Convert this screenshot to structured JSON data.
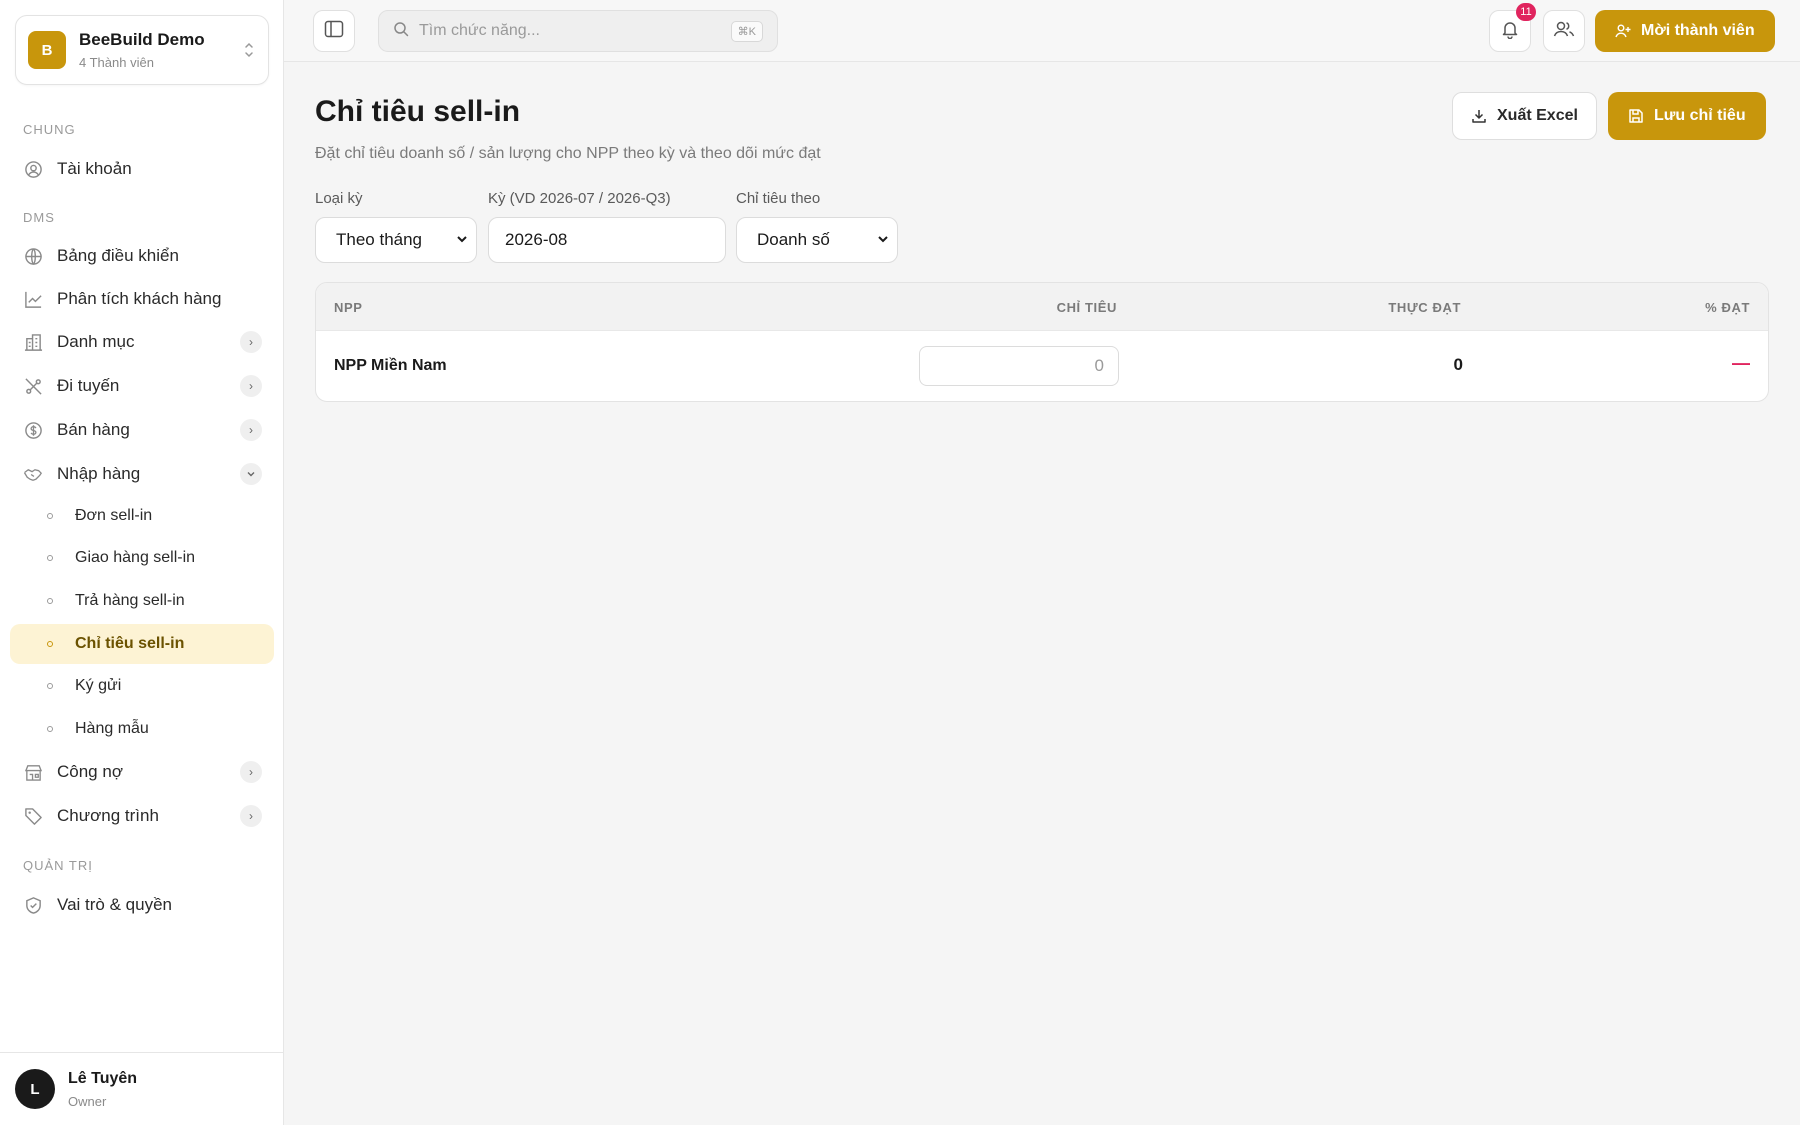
{
  "colors": {
    "accent": "#c8960c",
    "active_bg": "#fdf3d4",
    "badge": "#e0245e"
  },
  "workspace": {
    "logo_letter": "B",
    "name": "BeeBuild Demo",
    "members": "4 Thành viên"
  },
  "sidebar": {
    "sections": {
      "general": "CHUNG",
      "dms": "DMS",
      "admin": "QUẢN TRỊ"
    },
    "account": {
      "label": "Tài khoản",
      "icon": "user-circle-icon"
    },
    "dashboard": {
      "label": "Bảng điều khiển",
      "icon": "globe-icon"
    },
    "customer_analysis": {
      "label": "Phân tích khách hàng",
      "icon": "chart-line-icon"
    },
    "catalog": {
      "label": "Danh mục",
      "icon": "building-icon"
    },
    "routing": {
      "label": "Đi tuyến",
      "icon": "route-icon"
    },
    "sales": {
      "label": "Bán hàng",
      "icon": "dollar-icon"
    },
    "purchasing": {
      "label": "Nhập hàng",
      "icon": "handshake-icon",
      "children": [
        {
          "label": "Đơn sell-in"
        },
        {
          "label": "Giao hàng sell-in"
        },
        {
          "label": "Trả hàng sell-in"
        },
        {
          "label": "Chỉ tiêu sell-in"
        },
        {
          "label": "Ký gửi"
        },
        {
          "label": "Hàng mẫu"
        }
      ]
    },
    "debt": {
      "label": "Công nợ",
      "icon": "store-icon"
    },
    "programs": {
      "label": "Chương trình",
      "icon": "tag-icon"
    },
    "roles": {
      "label": "Vai trò & quyền",
      "icon": "shield-icon"
    }
  },
  "user": {
    "initial": "L",
    "name": "Lê Tuyên",
    "role": "Owner"
  },
  "topbar": {
    "search_placeholder": "Tìm chức năng...",
    "shortcut": "⌘K",
    "notification_count": "11",
    "invite_label": "Mời thành viên"
  },
  "page": {
    "title": "Chỉ tiêu sell-in",
    "subtitle": "Đặt chỉ tiêu doanh số / sản lượng cho NPP theo kỳ và theo dõi mức đạt",
    "export_label": "Xuất Excel",
    "save_label": "Lưu chỉ tiêu"
  },
  "filters": {
    "period_type": {
      "label": "Loại kỳ",
      "value": "Theo tháng"
    },
    "period": {
      "label": "Kỳ (VD 2026-07 / 2026-Q3)",
      "value": "2026-08"
    },
    "target_by": {
      "label": "Chỉ tiêu theo",
      "value": "Doanh số"
    }
  },
  "table": {
    "headers": {
      "npp": "NPP",
      "target": "CHỈ TIÊU",
      "actual": "THỰC ĐẠT",
      "percent": "% ĐẠT"
    },
    "rows": [
      {
        "npp": "NPP Miền Nam",
        "target_placeholder": "0",
        "actual": "0",
        "percent": "—"
      }
    ]
  }
}
